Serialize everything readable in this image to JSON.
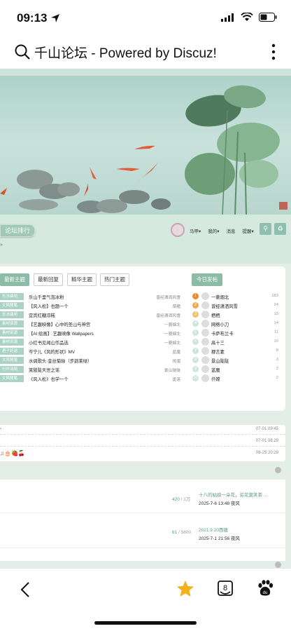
{
  "status_bar": {
    "time": "09:13"
  },
  "browser": {
    "title": "千山论坛 - Powered by Discuz!"
  },
  "nav": {
    "rank_button": "论坛排行",
    "links": [
      "马甲▾",
      "我的▾",
      "消息",
      "提醒▾"
    ]
  },
  "tabs": [
    {
      "label": "最新主题",
      "active": true
    },
    {
      "label": "最新回复",
      "active": false
    },
    {
      "label": "精华主题",
      "active": false
    },
    {
      "label": "热门主题",
      "active": false
    }
  ],
  "today_button": "今日发帖",
  "threads": [
    {
      "tag": "乐水曲苑",
      "title": "乐山千里气泡冰粉",
      "author": "曾经潇洒风雪"
    },
    {
      "tag": "文风随笔",
      "title": "【风入松】也题一个",
      "author": "菜猪"
    },
    {
      "tag": "乐水曲苑",
      "title": "宜宾红糖凉糕",
      "author": "曾经潇洒风雪"
    },
    {
      "tag": "素材资源",
      "title": "【艺趣映像】心中的圣山与神宫",
      "author": "一蓑烟北"
    },
    {
      "tag": "素材资源",
      "title": "【AI 绘画】 艺趣映像 Wallpapers",
      "author": "一蓑烟北"
    },
    {
      "tag": "素材资源",
      "title": "小红书见闻山作品选",
      "author": "一蓑烟北"
    },
    {
      "tag": "君子好逑",
      "title": "岑宁儿《风的形状》MV",
      "author": "蓝魔"
    },
    {
      "tag": "文风随笔",
      "title": "水调歌头·金丝菊絲（步韵莱绿）",
      "author": "闹湄"
    },
    {
      "tag": "行吟诗苑",
      "title": "莱陂陡天世之谣",
      "author": "景山陡陡"
    },
    {
      "tag": "文风随笔",
      "title": "《风入松》也学一个",
      "author": "墨洛"
    }
  ],
  "today_posters": [
    {
      "rank": "1",
      "name": "一蓑烟北",
      "count": "183"
    },
    {
      "rank": "2",
      "name": "曾经潇洒风雪",
      "count": "24"
    },
    {
      "rank": "3",
      "name": "栖栖",
      "count": "15"
    },
    {
      "rank": "4",
      "name": "网络小刀",
      "count": "14"
    },
    {
      "rank": "5",
      "name": "卡萨布兰卡",
      "count": "11"
    },
    {
      "rank": "6",
      "name": "高十三",
      "count": "10"
    },
    {
      "rank": "7",
      "name": "穆言素",
      "count": "8"
    },
    {
      "rank": "8",
      "name": "景山陡陡",
      "count": "3"
    },
    {
      "rank": "9",
      "name": "蓝魔",
      "count": "2"
    },
    {
      "rank": "10",
      "name": "仟嫦",
      "count": "2"
    }
  ],
  "announcements": [
    {
      "date": "07-01 09:45"
    },
    {
      "date": "07-01 08:29"
    },
    {
      "date": "08-25 20:29"
    }
  ],
  "forums": [
    {
      "count": "420",
      "total": "/ 1万",
      "last_title": "十八的姑娘一朵花，贫花莫笑茶 ...",
      "last_meta": "2025-7-6 13:48 夜风"
    },
    {
      "count": "81",
      "total": "/ 5800",
      "last_title": "2021.9.20西塘",
      "last_meta": "2025-7-1 21:56 夜风"
    }
  ],
  "colors": {
    "accent": "#8cbba8",
    "bg": "#e4eee8",
    "star": "#f3b21a"
  },
  "icons": [
    "search-icon",
    "more-icon",
    "back-icon",
    "star-icon",
    "box8-icon",
    "paw-icon"
  ]
}
